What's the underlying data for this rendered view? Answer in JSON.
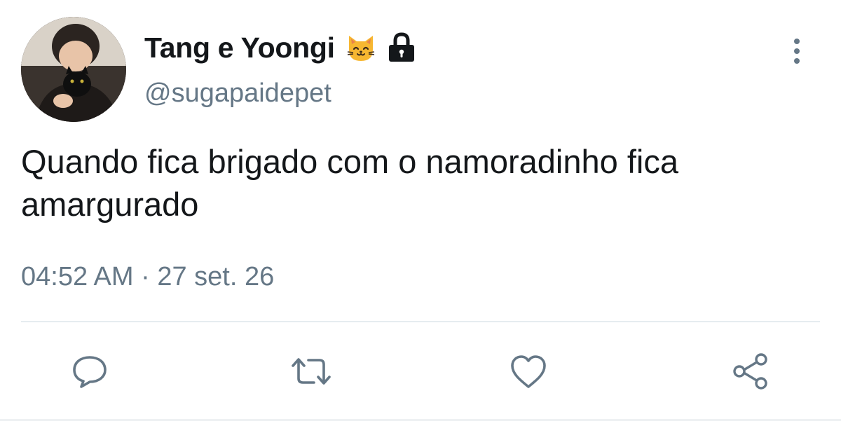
{
  "author": {
    "display_name": "Tang e Yoongi",
    "handle": "@sugapaidepet",
    "badges": [
      "cat-face-emoji-icon",
      "lock-icon"
    ]
  },
  "tweet": {
    "text": "Quando fica brigado com o namoradinho fica amargurado",
    "time": "04:52 AM",
    "separator": "·",
    "date": "27 set. 26"
  },
  "actions": [
    {
      "name": "reply",
      "icon": "speech-bubble-icon"
    },
    {
      "name": "retweet",
      "icon": "retweet-arrows-icon"
    },
    {
      "name": "like",
      "icon": "heart-icon"
    },
    {
      "name": "share",
      "icon": "share-nodes-icon"
    }
  ],
  "colors": {
    "text_primary": "#14171a",
    "text_secondary": "#657786",
    "icon_gray": "#657786",
    "divider": "#e6ecf0",
    "emoji_yellow": "#f7b731"
  }
}
